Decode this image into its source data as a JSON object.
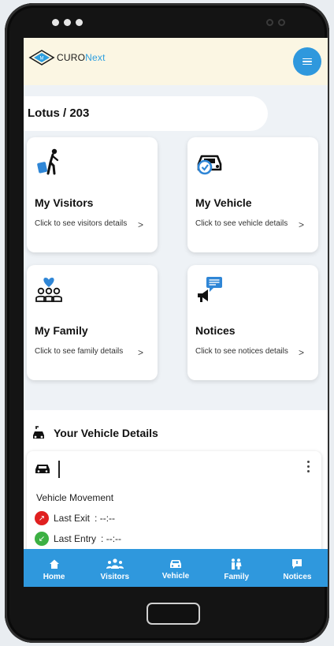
{
  "app": {
    "logo_brand": "CURO",
    "logo_suffix": "Next"
  },
  "flat": {
    "label": "Lotus / 203"
  },
  "cards": [
    {
      "title": "My Visitors",
      "desc": "Click to see visitors details",
      "icon": "visitor-luggage-icon"
    },
    {
      "title": "My Vehicle",
      "desc": "Click to see vehicle details",
      "icon": "car-check-icon"
    },
    {
      "title": "My Family",
      "desc": "Click to see family details",
      "icon": "family-heart-icon"
    },
    {
      "title": "Notices",
      "desc": "Click to see notices details",
      "icon": "megaphone-message-icon"
    }
  ],
  "vehicle": {
    "section_title": "Your Vehicle Details",
    "movement_label": "Vehicle Movement",
    "last_exit_label": "Last Exit",
    "last_exit_value": ": --:--",
    "last_entry_label": "Last Entry",
    "last_entry_value": ": --:--"
  },
  "nav": [
    {
      "label": "Home",
      "icon": "home-icon"
    },
    {
      "label": "Visitors",
      "icon": "visitors-icon"
    },
    {
      "label": "Vehicle",
      "icon": "car-icon"
    },
    {
      "label": "Family",
      "icon": "family-icon"
    },
    {
      "label": "Notices",
      "icon": "notices-icon"
    }
  ],
  "colors": {
    "primary": "#2f98dd",
    "appbar_bg": "#fbf6e3",
    "exit_red": "#e02020",
    "entry_green": "#3cb043",
    "icon_blue": "#2f86d6"
  }
}
